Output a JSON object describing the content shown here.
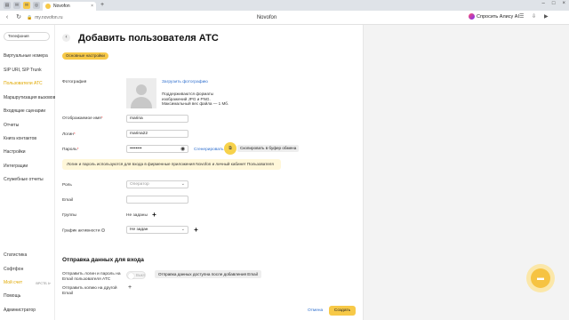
{
  "browser": {
    "tab_title": "Novofon",
    "url": "my.novofon.ru",
    "page_title": "Novofon",
    "ask_ai_label": "Спросить Алису AI"
  },
  "sidebar": {
    "selector": "Телефония",
    "items": [
      "Виртуальные номера",
      "SIP URI, SIP Trunk",
      "Пользователи АТС",
      "Маршрутизация вызовов",
      "Входящие сценарии",
      "Отчеты",
      "Книга контактов",
      "Настройки",
      "Интеграции",
      "Служебные отчеты"
    ],
    "bottom_items": [
      "Статистика",
      "Софтфон",
      "Мой счет",
      "Помощь",
      "Администратор"
    ],
    "account_tag": "ВРСТБ ⊳"
  },
  "main": {
    "title": "Добавить пользователя АТС",
    "section_chip": "Основные настройки",
    "photo_label": "Фотография",
    "upload_link": "Загрузить фотографию",
    "photo_hint": "Поддерживаются форматы изображений JPG и PNG. Максимальный вес файла — 1 Мб.",
    "display_name_label": "Отображаемое имя",
    "display_name_value": "marina",
    "login_label": "Логин",
    "login_value": "marina22",
    "password_label": "Пароль",
    "password_value": "••••••••",
    "generate_link": "Сгенерировать",
    "copy_tooltip": "Скопировать в буфер обмена",
    "info_note": "Логин и пароль используются для входа в фирменные приложения Novofon и личный кабинет Пользователя",
    "role_label": "Роль",
    "role_value": "Оператор",
    "email_label": "Email",
    "email_value": "",
    "groups_label": "Группы",
    "groups_value": "Не заданы",
    "schedule_label": "График активности",
    "schedule_value": "Не задан",
    "send_section_title": "Отправка данных для входа",
    "send_email_label": "Отправить логин и пароль на Email пользователя АТС",
    "toggle_label": "Выкл",
    "send_tooltip": "Отправка данных доступна после добавления Email",
    "send_copy_label": "Отправить копию на другой Email",
    "cancel_label": "Отмена",
    "create_label": "Создать"
  },
  "colors": {
    "accent": "#f7c948",
    "link": "#2f6fce",
    "active_nav": "#e0a800"
  }
}
